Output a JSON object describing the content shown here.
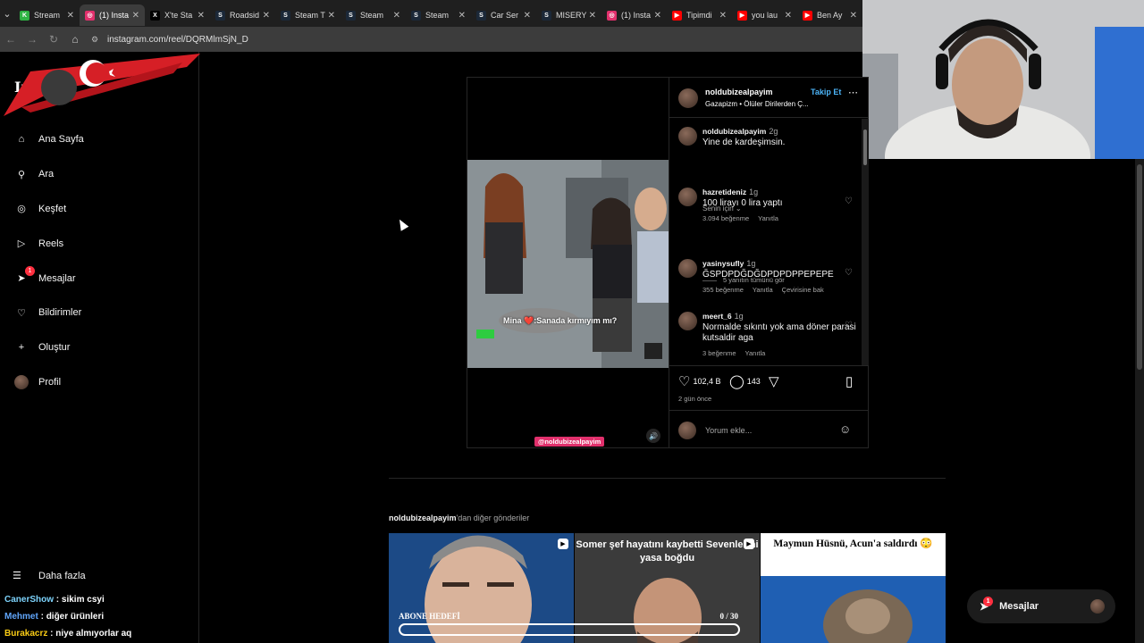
{
  "browser": {
    "tabs": [
      {
        "label": "Stream",
        "fav": "#2fb344",
        "favtext": "K",
        "active": false
      },
      {
        "label": "(1) Insta",
        "fav": "#e1306c",
        "favtext": "◎",
        "active": true
      },
      {
        "label": "X'te Sta",
        "fav": "#000000",
        "favtext": "X",
        "active": false
      },
      {
        "label": "Roadsid",
        "fav": "#1b2838",
        "favtext": "S",
        "active": false
      },
      {
        "label": "Steam T",
        "fav": "#1b2838",
        "favtext": "S",
        "active": false
      },
      {
        "label": "Steam",
        "fav": "#1b2838",
        "favtext": "S",
        "active": false
      },
      {
        "label": "Steam",
        "fav": "#1b2838",
        "favtext": "S",
        "active": false
      },
      {
        "label": "Car Ser",
        "fav": "#1b2838",
        "favtext": "S",
        "active": false
      },
      {
        "label": "MISERY",
        "fav": "#1b2838",
        "favtext": "S",
        "active": false
      },
      {
        "label": "(1) Insta",
        "fav": "#e1306c",
        "favtext": "◎",
        "active": false
      },
      {
        "label": "Tipimdi",
        "fav": "#ff0000",
        "favtext": "▶",
        "active": false
      },
      {
        "label": "you lau",
        "fav": "#ff0000",
        "favtext": "▶",
        "active": false
      },
      {
        "label": "Ben Ay",
        "fav": "#ff0000",
        "favtext": "▶",
        "active": false
      }
    ],
    "url": "instagram.com/reel/DQRMlmSjN_D"
  },
  "sidebar": {
    "logo": "Insta",
    "items": [
      {
        "label": "Ana Sayfa",
        "icon": "home-icon",
        "glyph": "⌂"
      },
      {
        "label": "Ara",
        "icon": "search-icon",
        "glyph": "⚲"
      },
      {
        "label": "Keşfet",
        "icon": "compass-icon",
        "glyph": "◎"
      },
      {
        "label": "Reels",
        "icon": "reels-icon",
        "glyph": "▷"
      },
      {
        "label": "Mesajlar",
        "icon": "messenger-icon",
        "glyph": "➤",
        "badge": "1"
      },
      {
        "label": "Bildirimler",
        "icon": "heart-icon",
        "glyph": "♡"
      },
      {
        "label": "Oluştur",
        "icon": "plus-icon",
        "glyph": "+"
      },
      {
        "label": "Profil",
        "icon": "avatar",
        "glyph": "●"
      }
    ],
    "more_label": "Daha fazla"
  },
  "chat": [
    {
      "user": "CanerShow",
      "msg": "sikim csyi"
    },
    {
      "user": "Mehmet",
      "msg": "diğer ürünleri"
    },
    {
      "user": "Burakacrz",
      "msg": "niye almıyorlar aq"
    }
  ],
  "post": {
    "username": "noldubizealpayim",
    "follow": "Takip Et",
    "audio": "Gazapizm • Ölüler Dirilerden Ç...",
    "video_caption": "Mina ❤️:Sanada kırmıyım mı?",
    "watermark": "@noldubizealpayim",
    "owner_comment": {
      "name": "noldubizealpayim",
      "time": "2g",
      "text": "Yine de kardeşimsin."
    },
    "sort_label": "Senin için ⌄",
    "comments": [
      {
        "name": "hazretideniz",
        "time": "1g",
        "text": "100 lirayı 0 lira yaptı",
        "likes": "3.094 beğenme",
        "reply": "Yanıtla",
        "extra": ""
      },
      {
        "name": "yasinysufly",
        "time": "1g",
        "text": "ĞSPDPDĞDĞDPDPDPPEPEPE",
        "likes": "355 beğenme",
        "reply": "Yanıtla",
        "extra": "Çevirisine bak"
      },
      {
        "name": "meert_6",
        "time": "1g",
        "text": "Normalde sıkıntı yok ama döner parasi kutsaldir aga",
        "likes": "3 beğenme",
        "reply": "Yanıtla",
        "extra": ""
      }
    ],
    "replies_label": "5 yanıtın tümünü gör",
    "likes": "102,4 B",
    "comment_count": "143",
    "time_ago": "2 gün önce",
    "add_comment": "Yorum ekle..."
  },
  "more_from": {
    "user": "noldubizealpayim",
    "suffix": "'dan diğer gönderiler"
  },
  "thumbs": [
    {
      "title": ""
    },
    {
      "title": "Somer şef hayatını kaybetti Sevenlerini yasa boğdu"
    },
    {
      "title": "Maymun Hüsnü, Acun'a saldırdı 😳"
    }
  ],
  "stream_overlay": {
    "abone_label": "ABONE HEDEFİ",
    "abone_count": "0 / 30",
    "abone_progress": 0
  },
  "dm_bar": {
    "label": "Mesajlar",
    "badge": "1"
  }
}
